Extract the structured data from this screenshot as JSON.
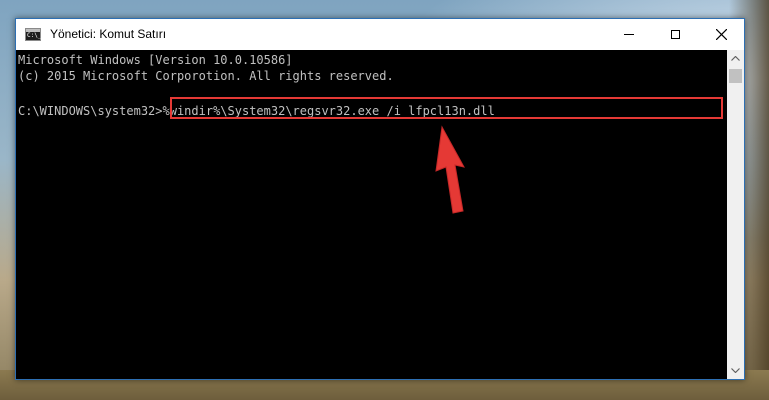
{
  "window": {
    "title": "Yönetici: Komut Satırı",
    "icon_text": "C:\\_"
  },
  "console": {
    "lines": [
      "Microsoft Windows [Version 10.0.10586]",
      "(c) 2015 Microsoft Corporotion. All rights reserved.",
      "",
      "C:\\WINDOWS\\system32>%windir%\\System32\\regsvr32.exe /i lfpcl13n.dll"
    ],
    "prompt": "C:\\WINDOWS\\system32>",
    "command": "%windir%\\System32\\regsvr32.exe /i lfpcl13n.dll"
  },
  "annotation": {
    "color": "#e53935"
  }
}
